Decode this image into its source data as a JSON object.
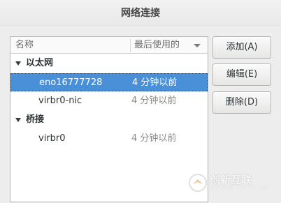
{
  "window": {
    "title": "网络连接"
  },
  "list": {
    "columns": {
      "name": "名称",
      "last_used": "最后使用的"
    },
    "groups": [
      {
        "label": "以太网",
        "items": [
          {
            "name": "eno16777728",
            "last_used": "4 分钟以前",
            "selected": true
          },
          {
            "name": "virbr0-nic",
            "last_used": "4 分钟以前",
            "selected": false
          }
        ]
      },
      {
        "label": "桥接",
        "items": [
          {
            "name": "virbr0",
            "last_used": "4 分钟以前",
            "selected": false
          }
        ]
      }
    ]
  },
  "buttons": {
    "add": "添加(A)",
    "edit": "编辑(E)",
    "delete": "删除(D)"
  },
  "watermark": {
    "text": "创新互联",
    "sub": "CHUANG XIN HU LIAN"
  },
  "colors": {
    "selection": "#4a90d9",
    "background": "#ededed"
  }
}
